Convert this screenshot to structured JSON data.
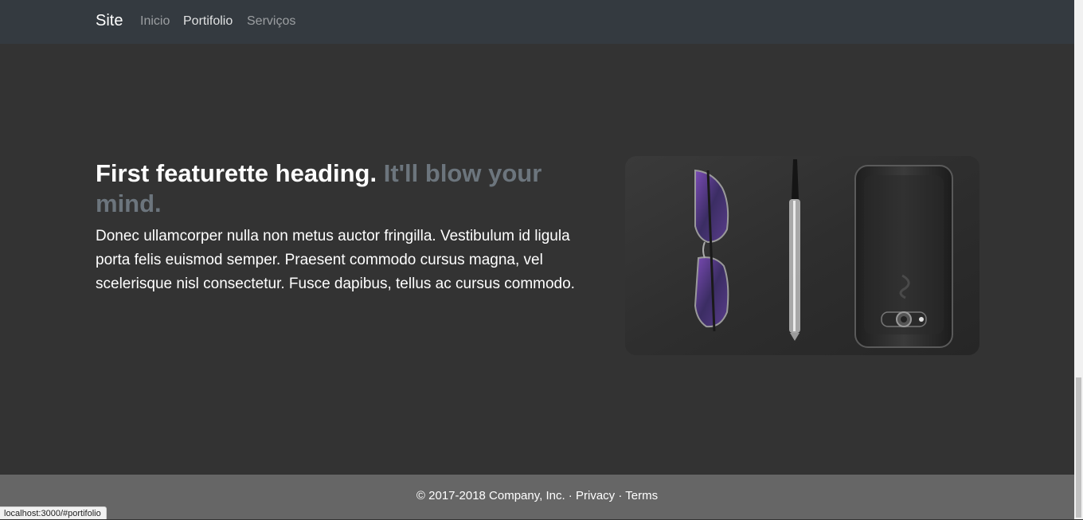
{
  "nav": {
    "brand": "Site",
    "items": [
      {
        "label": "Inicio",
        "active": false
      },
      {
        "label": "Portifolio",
        "active": true
      },
      {
        "label": "Serviços",
        "active": false
      }
    ]
  },
  "featurette": {
    "heading": "First featurette heading.",
    "heading_muted": "It'll blow your mind.",
    "lead": "Donec ullamcorper nulla non metus auctor fringilla. Vestibulum id ligula porta felis euismod semper. Praesent commodo cursus magna, vel scelerisque nisl consectetur. Fusce dapibus, tellus ac cursus commodo.",
    "image_subject": "glasses, pen and smartphone on dark surface"
  },
  "footer": {
    "copyright": "© 2017-2018 Company, Inc.",
    "sep1": " · ",
    "privacy": "Privacy",
    "sep2": " · ",
    "terms": "Terms"
  },
  "status_bar": {
    "url": "localhost:3000/#portifolio"
  },
  "colors": {
    "navbar_bg": "#343a40",
    "page_bg": "#333333",
    "footer_bg": "#666666",
    "muted": "#6c757d"
  }
}
